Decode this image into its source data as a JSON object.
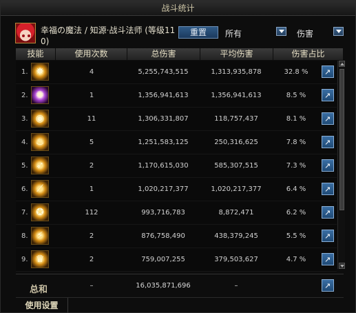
{
  "window": {
    "title": "战斗统计"
  },
  "header": {
    "char_name": "幸福の魔法 / 知源·战斗法师 (等级110)",
    "reset_label": "重置",
    "filter_scope": "所有",
    "filter_type": "伤害"
  },
  "columns": [
    "技能",
    "使用次数",
    "总伤害",
    "平均伤害",
    "伤害占比"
  ],
  "rows": [
    {
      "rank": "1.",
      "count": "4",
      "total": "5,255,743,515",
      "avg": "1,313,935,878",
      "share": "32.8 %",
      "icon": "skill-icon-burst"
    },
    {
      "rank": "2.",
      "count": "1",
      "total": "1,356,941,613",
      "avg": "1,356,941,613",
      "share": "8.5 %",
      "icon": "skill-icon-arcane"
    },
    {
      "rank": "3.",
      "count": "11",
      "total": "1,306,331,807",
      "avg": "118,757,437",
      "share": "8.1 %",
      "icon": "skill-icon-spiral"
    },
    {
      "rank": "4.",
      "count": "5",
      "total": "1,251,583,125",
      "avg": "250,316,625",
      "share": "7.8 %",
      "icon": "skill-icon-flame"
    },
    {
      "rank": "5.",
      "count": "2",
      "total": "1,170,615,030",
      "avg": "585,307,515",
      "share": "7.3 %",
      "icon": "skill-icon-beam"
    },
    {
      "rank": "6.",
      "count": "1",
      "total": "1,020,217,377",
      "avg": "1,020,217,377",
      "share": "6.4 %",
      "icon": "skill-icon-slash"
    },
    {
      "rank": "7.",
      "count": "112",
      "total": "993,716,783",
      "avg": "8,872,471",
      "share": "6.2 %",
      "icon": "skill-icon-star"
    },
    {
      "rank": "8.",
      "count": "2",
      "total": "876,758,490",
      "avg": "438,379,245",
      "share": "5.5 %",
      "icon": "skill-icon-strike"
    },
    {
      "rank": "9.",
      "count": "2",
      "total": "759,007,255",
      "avg": "379,503,627",
      "share": "4.7 %",
      "icon": "skill-icon-wings"
    }
  ],
  "total": {
    "label": "总和",
    "count": "–",
    "sum": "16,035,871,696",
    "avg": "–"
  },
  "footer": {
    "settings_label": "使用设置"
  }
}
